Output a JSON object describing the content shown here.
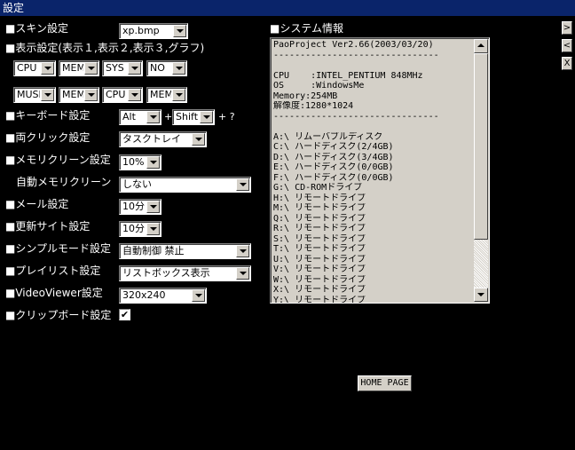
{
  "window": {
    "title": "設定"
  },
  "side_buttons": [
    ">",
    "<",
    "X"
  ],
  "settings": {
    "skin_label": "■スキン設定",
    "skin_value": "xp.bmp",
    "display_label": "■表示設定(表示１,表示２,表示３,グラフ)",
    "display_row1": [
      "CPU",
      "MEM",
      "SYS",
      "NO"
    ],
    "display_row2": [
      "MUSIC",
      "MEM",
      "CPU",
      "MEM"
    ],
    "keyboard_label": "■キーボード設定",
    "keyboard_mod1": "Alt",
    "keyboard_mod2": "Shift",
    "keyboard_plus": "+",
    "keyboard_tail": "+ ?",
    "doubleclick_label": "■両クリック設定",
    "doubleclick_value": "タスクトレイ",
    "memclean_label": "■メモリクリーン設定",
    "memclean_value": "10%",
    "automem_label": "自動メモリクリーン",
    "automem_value": "しない",
    "mail_label": "■メール設定",
    "mail_value": "10分",
    "update_label": "■更新サイト設定",
    "update_value": "10分",
    "simple_label": "■シンプルモード設定",
    "simple_value": "自動制御 禁止",
    "playlist_label": "■プレイリスト設定",
    "playlist_value": "リストボックス表示",
    "viewer_label": "■VideoViewer設定",
    "viewer_value": "320x240",
    "clipboard_label": "■クリップボード設定",
    "clipboard_checked": "✔"
  },
  "system_info": {
    "label": "■システム情報",
    "lines": [
      "PaoProject Ver2.66(2003/03/20)",
      "-------------------------------",
      "",
      "CPU    :INTEL_PENTIUM 848MHz",
      "OS     :WindowsMe",
      "Memory:254MB",
      "解像度:1280*1024",
      "-------------------------------",
      "",
      "A:\\ リムーバブルディスク",
      "C:\\ ハードディスク(2/4GB)",
      "D:\\ ハードディスク(3/4GB)",
      "E:\\ ハードディスク(0/0GB)",
      "F:\\ ハードディスク(0/0GB)",
      "G:\\ CD-ROMドライブ",
      "H:\\ リモートドライブ",
      "M:\\ リモートドライブ",
      "Q:\\ リモートドライブ",
      "R:\\ リモートドライブ",
      "S:\\ リモートドライブ",
      "T:\\ リモートドライブ",
      "U:\\ リモートドライブ",
      "V:\\ リモートドライブ",
      "W:\\ リモートドライブ",
      "X:\\ リモートドライブ",
      "Y:\\ リモートドライブ"
    ]
  },
  "home_button": "HOME PAGE"
}
